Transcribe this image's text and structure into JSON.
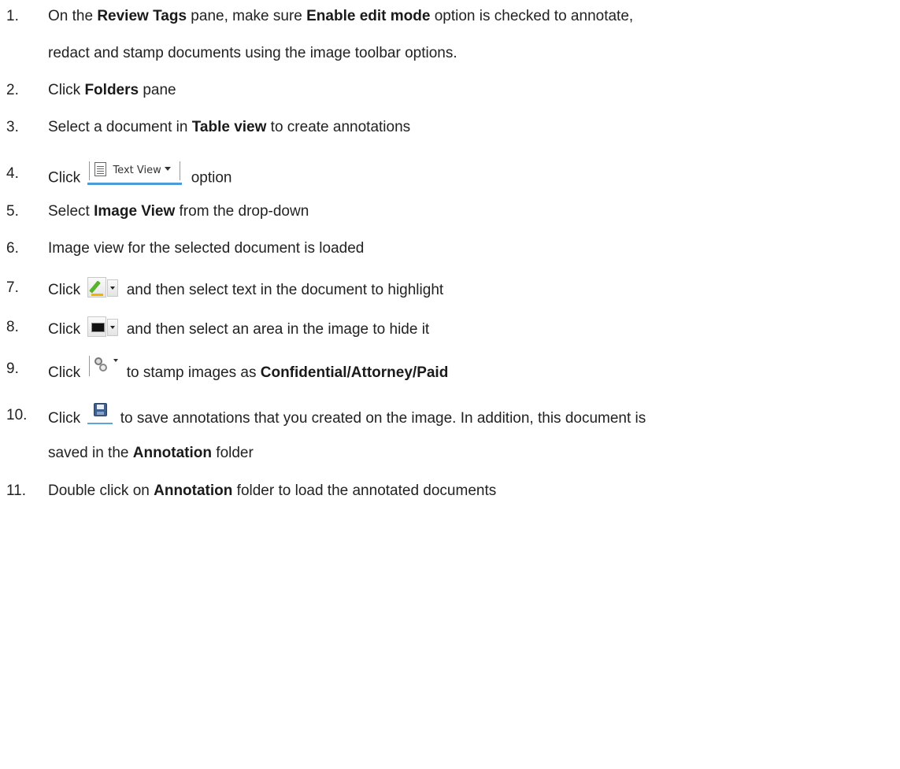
{
  "steps": [
    {
      "num": "1.",
      "parts": [
        {
          "t": "On the "
        },
        {
          "b": "Review Tags"
        },
        {
          "t": " pane, make sure "
        },
        {
          "b": "Enable edit mode"
        },
        {
          "t": " option is checked to annotate,"
        }
      ],
      "cont": [
        {
          "t": "redact and stamp documents using the image toolbar options."
        }
      ]
    },
    {
      "num": "2.",
      "parts": [
        {
          "t": "Click "
        },
        {
          "b": "Folders"
        },
        {
          "t": " pane"
        }
      ]
    },
    {
      "num": "3.",
      "parts": [
        {
          "t": "Select a document in "
        },
        {
          "b": "Table view"
        },
        {
          "t": " to create annotations"
        }
      ]
    },
    {
      "num": "4.",
      "parts": [
        {
          "t": "Click "
        },
        {
          "icon": "text-view-button"
        },
        {
          "t": " option"
        }
      ]
    },
    {
      "num": "5.",
      "parts": [
        {
          "t": "Select "
        },
        {
          "b": "Image View"
        },
        {
          "t": " from the drop-down"
        }
      ]
    },
    {
      "num": "6.",
      "parts": [
        {
          "t": "Image view for the selected document is loaded"
        }
      ]
    },
    {
      "num": "7.",
      "parts": [
        {
          "t": "Click "
        },
        {
          "icon": "highlight-button"
        },
        {
          "t": " and then select text in the document to highlight"
        }
      ]
    },
    {
      "num": "8.",
      "parts": [
        {
          "t": "Click "
        },
        {
          "icon": "redact-button"
        },
        {
          "t": " and then select an area in the image to hide it"
        }
      ]
    },
    {
      "num": "9.",
      "parts": [
        {
          "t": "Click "
        },
        {
          "icon": "stamp-button"
        },
        {
          "t": " to stamp images as "
        },
        {
          "b": "Confidential/Attorney/Paid"
        }
      ]
    },
    {
      "num": "10.",
      "parts": [
        {
          "t": "Click "
        },
        {
          "icon": "save-button"
        },
        {
          "t": " to save annotations that you created on the image. In addition, this document is"
        }
      ],
      "cont": [
        {
          "t": "saved in the "
        },
        {
          "b": "Annotation"
        },
        {
          "t": " folder"
        }
      ]
    },
    {
      "num": "11.",
      "parts": [
        {
          "t": "Double click on "
        },
        {
          "b": "Annotation"
        },
        {
          "t": " folder to load the annotated documents"
        }
      ]
    }
  ],
  "text_view_button": {
    "label": "Text View"
  }
}
